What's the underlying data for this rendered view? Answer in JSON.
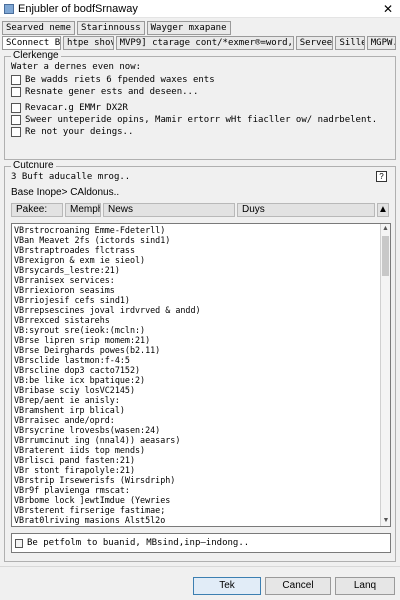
{
  "window": {
    "title": "Enjubler of bodfSrnaway",
    "close_glyph": "✕"
  },
  "tabs_row1": [
    "Searved neme",
    "Starinnouss",
    "Wayger mxapane"
  ],
  "tabs_row2": [
    "SConnect Brw",
    "htpe shov.",
    "MVP9] ctarage cont/*exmer®=word,*laviet.",
    "Servee.",
    "Sille",
    "MGPW."
  ],
  "options_group": {
    "title": "Clerkenge",
    "subtitle": "Water a dernes even now:",
    "checkboxes_a": [
      "Be wadds riets 6 fpended waxes ents",
      "Resnate gener ests and deseen..."
    ],
    "checkboxes_b": [
      "Revacar.g EMMr DX2R",
      "Sweer unteperide opins, Mamir ertorr wHt fiacller ow/ nadrbelent.",
      "Re not your deings.."
    ]
  },
  "content_group": {
    "title": "Cutcnure",
    "line1": "3 Buft aducalle mrog..",
    "help_glyph": "?",
    "line2": "Base Inope> CAldonus..",
    "columns": [
      "Pakee:",
      "Memphe:",
      "News",
      "Duys"
    ],
    "list_rows": [
      "VBrstrocroaning Emme-Fdeterll)",
      "VBan Meavet 2fs (ictords sind1)",
      "VBrstraptroades flctrass",
      "VBrexigron & exm ie sieol)",
      "VBrsycards_lestre:21)",
      "VBrranisex services:",
      "VBrriexioron seasims",
      "VBrriojesif cefs sind1)",
      "VBrrepsescines joval irdvrved & andd)",
      "VBrrexced sistarehs",
      "VB:syrout sre(ieok:(mcln:)",
      "VBrse lipren srip momem:21)",
      "VBrse Deirghards powes(b2.11)",
      "VBrsclide lastmon:f-4:5",
      "VBrscline dop3 cacto7152)",
      "VB:be like icx bpatique:2)",
      "VBribase sciy losVC2145)",
      "VBrep/aent ie anisly:",
      "VBramshent irp blical)",
      "VBrraisec ande/oprd:",
      "VBrsycrine lrovesbs(wasen:24)",
      "VBrrumcinut ing (nnal4)) aeasars)",
      "VBraterent iids top mends)",
      "VBrlisci pand fasten:21)",
      "VBr stont firapolyle:21)",
      "VBrstrip Irsewerisfs (Wirsdriph)",
      "VBr9f plavienga rmscat:",
      "VBrbome lock ]ewtImdue (Yewries",
      "VBrsterent firserige fastimae;",
      "VBrat0lriving masions Alst5l2o",
      "VBr ae lake now evlr)",
      "VB:blal cnpllilly gening:",
      "VBr wrecec2.31 AdUerl)",
      "VLapont to poilly:",
      "Vindopplr.fisl:2)"
    ],
    "status_text": "Be petfolm to buanid, MBsind,inp—indong.."
  },
  "buttons": {
    "ok": "Tek",
    "cancel": "Cancel",
    "apply": "Lanq"
  }
}
